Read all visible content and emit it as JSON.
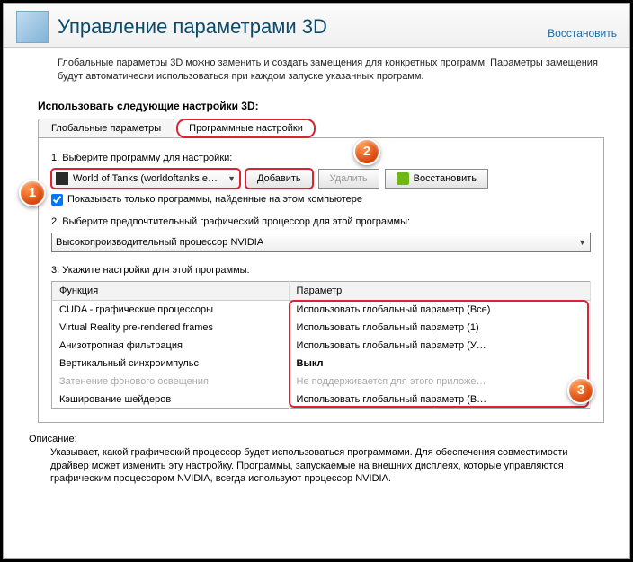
{
  "header": {
    "title": "Управление параметрами 3D",
    "restore": "Восстановить"
  },
  "intro": "Глобальные параметры 3D можно заменить и создать замещения для конкретных программ. Параметры замещения будут автоматически использоваться при каждом запуске указанных программ.",
  "section_label": "Использовать следующие настройки 3D:",
  "tabs": {
    "global": "Глобальные параметры",
    "program": "Программные настройки"
  },
  "step1": {
    "label": "1. Выберите программу для настройки:",
    "program": "World of Tanks (worldoftanks.e…",
    "add": "Добавить",
    "remove": "Удалить",
    "restore": "Восстановить"
  },
  "checkbox_label": "Показывать только программы, найденные на этом компьютере",
  "step2": {
    "label": "2. Выберите предпочтительный графический процессор для этой программы:",
    "value": "Высокопроизводительный процессор NVIDIA"
  },
  "step3": {
    "label": "3. Укажите настройки для этой программы:",
    "col_function": "Функция",
    "col_param": "Параметр",
    "rows": [
      {
        "func": "CUDA - графические процессоры",
        "param": "Использовать глобальный параметр (Все)",
        "dim": false
      },
      {
        "func": "Virtual Reality pre-rendered frames",
        "param": "Использовать глобальный параметр (1)",
        "dim": false
      },
      {
        "func": "Анизотропная фильтрация",
        "param": "Использовать глобальный параметр (У…",
        "dim": false
      },
      {
        "func": "Вертикальный синхроимпульс",
        "param": "Выкл",
        "dim": false,
        "bold": true
      },
      {
        "func": "Затенение фонового освещения",
        "param": "Не поддерживается для этого приложе…",
        "dim": true
      },
      {
        "func": "Кэширование шейдеров",
        "param": "Использовать глобальный параметр (В…",
        "dim": false
      }
    ]
  },
  "description": {
    "label": "Описание:",
    "text": "Указывает, какой графический процессор будет использоваться программами. Для обеспечения совместимости драйвер может изменить эту настройку. Программы, запускаемые на внешних дисплеях, которые управляются графическим процессором NVIDIA, всегда используют процессор NVIDIA."
  },
  "callouts": {
    "c1": "1",
    "c2": "2",
    "c3": "3"
  }
}
